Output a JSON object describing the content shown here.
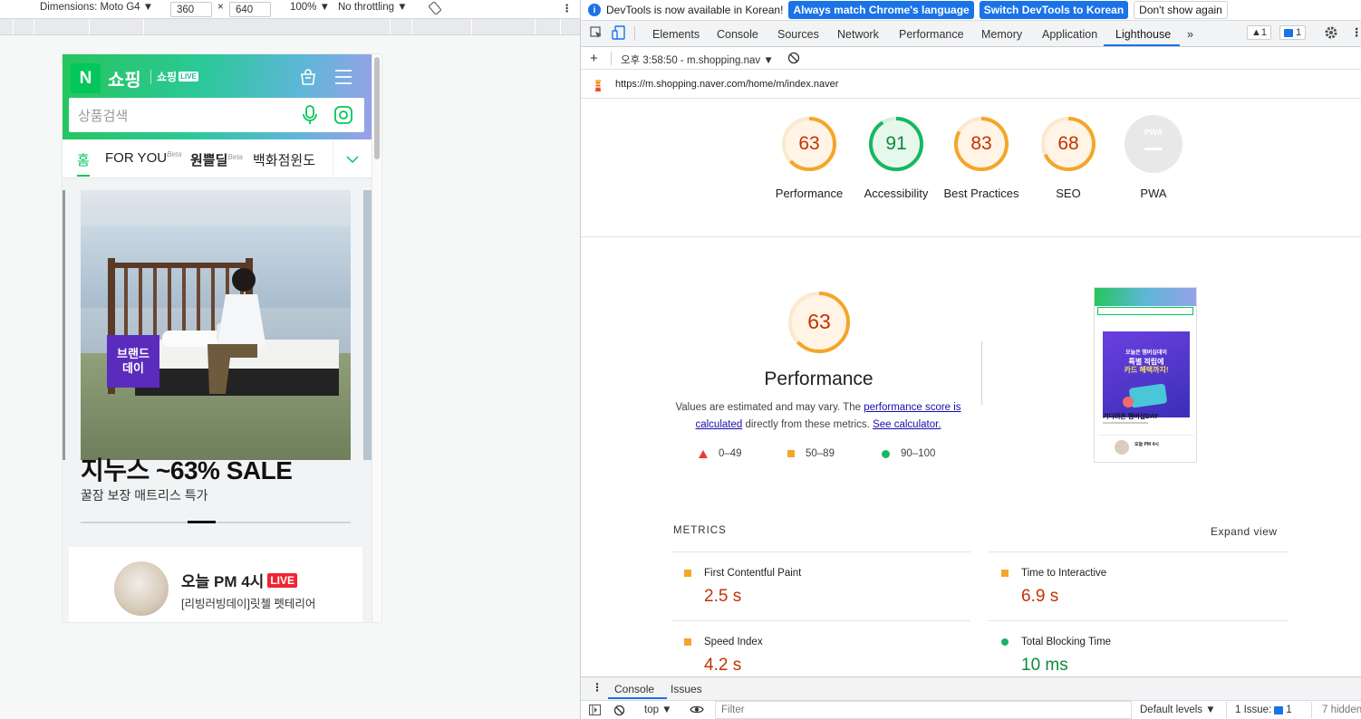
{
  "device_toolbar": {
    "dimensions_label": "Dimensions: Moto G4 ▼",
    "width": "360",
    "times": "×",
    "height": "640",
    "zoom": "100% ▼",
    "throttling": "No throttling ▼",
    "more": "⋮"
  },
  "phone": {
    "logo": "N",
    "brand": "쇼핑",
    "live_brand": "쇼핑",
    "live_tag": "LIVE",
    "search_placeholder": "상품검색",
    "tabs": [
      {
        "label": "홈",
        "active": true
      },
      {
        "label": "FOR YOU",
        "sup": "Beta"
      },
      {
        "label": "원쁠딜",
        "sup": "Beta"
      },
      {
        "label": "백화점윈도"
      }
    ],
    "banner": {
      "badge_line1": "브랜드",
      "badge_line2": "데이",
      "title": "지누스 ~63% SALE",
      "subtitle": "꿀잠 보장 매트리스 특가"
    },
    "live_card": {
      "title": "오늘 PM 4시",
      "live": "LIVE",
      "subtitle": "[리빙러빙데이]릿첼 펫테리어"
    }
  },
  "devtools": {
    "infobar": {
      "message": "DevTools is now available in Korean!",
      "btn_match": "Always match Chrome's language",
      "btn_switch": "Switch DevTools to Korean",
      "btn_dismiss": "Don't show again"
    },
    "tabs": [
      "Elements",
      "Console",
      "Sources",
      "Network",
      "Performance",
      "Memory",
      "Application",
      "Lighthouse"
    ],
    "active_tab": "Lighthouse",
    "overflow": "»",
    "warnings_badge": "▲1",
    "issues_badge": "1",
    "report_select": "오후 3:58:50 - m.shopping.nav ▼",
    "url": "https://m.shopping.naver.com/home/m/index.naver",
    "scores": [
      {
        "label": "Performance",
        "value": 63,
        "color": "#e67700"
      },
      {
        "label": "Accessibility",
        "value": 91,
        "color": "#0c8a3d"
      },
      {
        "label": "Best Practices",
        "value": 83,
        "color": "#e67700"
      },
      {
        "label": "SEO",
        "value": 68,
        "color": "#e67700"
      },
      {
        "label": "PWA",
        "value": null,
        "text": "PWA"
      }
    ],
    "performance": {
      "score": "63",
      "title": "Performance",
      "desc_pre": "Values are estimated and may vary. The ",
      "desc_link": "performance score is calculated",
      "desc_mid": " directly from these metrics. ",
      "desc_link2": "See calculator.",
      "legend": [
        {
          "range": "0–49",
          "color": "#eb3c2f"
        },
        {
          "range": "50–89",
          "color": "#f4a62a"
        },
        {
          "range": "90–100",
          "color": "#18b663"
        }
      ]
    },
    "thumbnail": {
      "headline1": "오늘은 멤버십데이",
      "headline2": "특별 적립에",
      "headline3": "카드 혜택까지!",
      "caption": "기다려온 멤버십DAY",
      "live": "오늘 PM 4시"
    },
    "metrics": {
      "header": "METRICS",
      "expand": "Expand view",
      "items": [
        {
          "name": "First Contentful Paint",
          "value": "2.5 s",
          "status": "average"
        },
        {
          "name": "Time to Interactive",
          "value": "6.9 s",
          "status": "average"
        },
        {
          "name": "Speed Index",
          "value": "4.2 s",
          "status": "average"
        },
        {
          "name": "Total Blocking Time",
          "value": "10 ms",
          "status": "pass"
        }
      ]
    },
    "drawer": {
      "console": "Console",
      "issues": "Issues"
    },
    "consolebar": {
      "context": "top ▼",
      "filter": "Filter",
      "levels": "Default levels ▼",
      "issues": "1 Issue:",
      "issues_count": "1",
      "hidden": "7 hidden"
    },
    "colors": {
      "accent": "#1a73e8",
      "average": "#c33300",
      "pass": "#0c8a3d"
    }
  }
}
